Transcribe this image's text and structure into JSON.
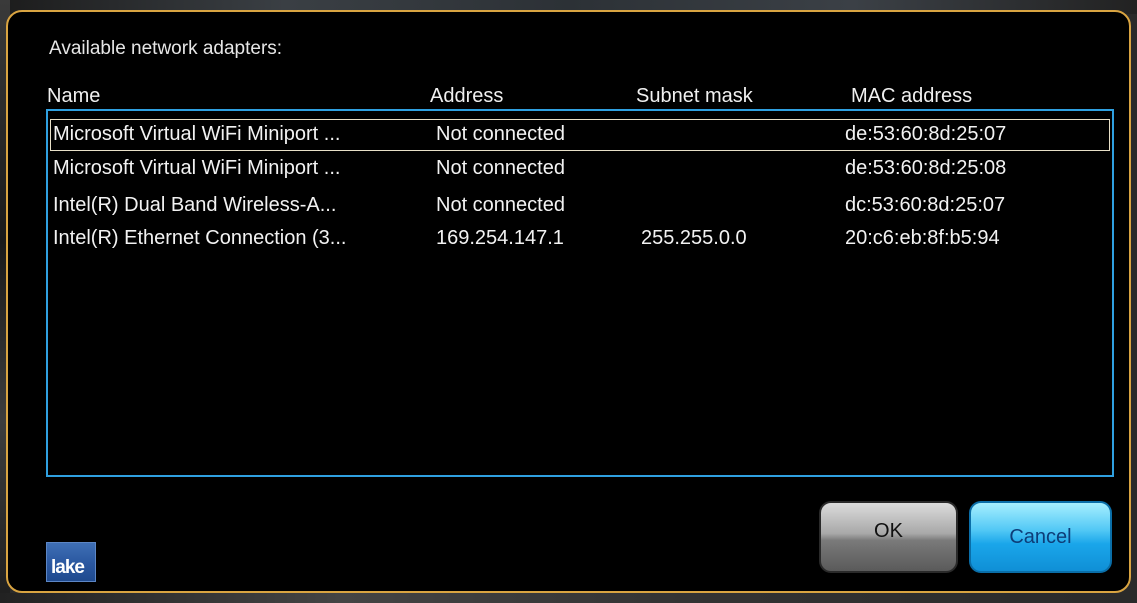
{
  "dialog": {
    "title": "Available network adapters:"
  },
  "columns": {
    "name": "Name",
    "address": "Address",
    "subnet": "Subnet mask",
    "mac": "MAC address"
  },
  "adapters": [
    {
      "name": "Microsoft Virtual WiFi Miniport ...",
      "address": "Not connected",
      "subnet": "",
      "mac": "de:53:60:8d:25:07",
      "selected": true
    },
    {
      "name": "Microsoft Virtual WiFi Miniport ...",
      "address": "Not connected",
      "subnet": "",
      "mac": "de:53:60:8d:25:08",
      "selected": false
    },
    {
      "name": "Intel(R) Dual Band Wireless-A...",
      "address": "Not connected",
      "subnet": "",
      "mac": "dc:53:60:8d:25:07",
      "selected": false
    },
    {
      "name": "Intel(R) Ethernet Connection (3...",
      "address": "169.254.147.1",
      "subnet": "255.255.0.0",
      "mac": "20:c6:eb:8f:b5:94",
      "selected": false
    }
  ],
  "buttons": {
    "ok": "OK",
    "cancel": "Cancel"
  },
  "logo": {
    "text": "lake"
  },
  "colors": {
    "frame": "#d9a441",
    "list_border": "#2fa0e0",
    "cancel_accent": "#1aa6ea"
  }
}
